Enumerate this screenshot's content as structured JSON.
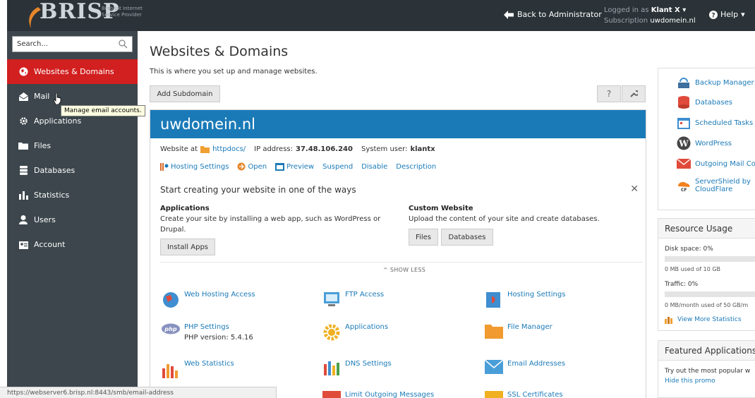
{
  "topbar": {
    "logo_text": "BRISP",
    "logo_tag_line1": "Brabant Internet",
    "logo_tag_line2": "Service Provider",
    "back_label": "Back to Administrator",
    "logged_in_label": "Logged in as",
    "user": "Klant X",
    "subscription_label": "Subscription",
    "subscription": "uwdomein.nl",
    "help_label": "Help"
  },
  "sidebar": {
    "search_placeholder": "Search...",
    "items": [
      {
        "label": "Websites & Domains",
        "icon": "globe-icon"
      },
      {
        "label": "Mail",
        "icon": "mail-icon"
      },
      {
        "label": "Applications",
        "icon": "gear-icon"
      },
      {
        "label": "Files",
        "icon": "folder-icon"
      },
      {
        "label": "Databases",
        "icon": "database-icon"
      },
      {
        "label": "Statistics",
        "icon": "bar-chart-icon"
      },
      {
        "label": "Users",
        "icon": "user-icon"
      },
      {
        "label": "Account",
        "icon": "account-icon"
      }
    ],
    "tooltip": "Manage email accounts."
  },
  "main": {
    "title": "Websites & Domains",
    "subtitle": "This is where you set up and manage websites.",
    "add_subdomain": "Add Subdomain",
    "help_q": "?",
    "domain": {
      "name": "uwdomein.nl",
      "website_at": "Website at",
      "docroot": "httpdocs/",
      "ip_label": "IP address:",
      "ip": "37.48.106.240",
      "sysuser_label": "System user:",
      "sysuser": "klantx",
      "actions": [
        "Hosting Settings",
        "Open",
        "Preview",
        "Suspend",
        "Disable",
        "Description"
      ]
    },
    "create": {
      "title": "Start creating your website in one of the ways",
      "apps_heading": "Applications",
      "apps_text_1": "Create your site by installing a web app, such as WordPress or",
      "apps_text_2": "Drupal.",
      "install_apps": "Install Apps",
      "custom_heading": "Custom Website",
      "custom_text": "Upload the content of your site and create databases.",
      "files_btn": "Files",
      "db_btn": "Databases",
      "show_less": "SHOW LESS"
    },
    "tools": [
      {
        "label": "Web Hosting Access",
        "icon": "web-hosting-access-icon"
      },
      {
        "label": "FTP Access",
        "icon": "ftp-access-icon"
      },
      {
        "label": "Hosting Settings",
        "icon": "hosting-settings-icon"
      },
      {
        "label": "PHP Settings",
        "sub": "PHP version: 5.4.16",
        "icon": "php-icon"
      },
      {
        "label": "Applications",
        "icon": "applications-gear-icon"
      },
      {
        "label": "File Manager",
        "icon": "file-manager-icon"
      },
      {
        "label": "Web Statistics",
        "icon": "web-statistics-icon"
      },
      {
        "label": "DNS Settings",
        "icon": "dns-settings-icon"
      },
      {
        "label": "Email Addresses",
        "icon": "email-addresses-icon"
      },
      {
        "label": "Limit Outgoing Messages",
        "icon": "limit-messages-icon"
      },
      {
        "label": "SSL Certificates",
        "icon": "ssl-certificates-icon"
      }
    ]
  },
  "right": {
    "links": [
      {
        "label": "Backup Manager",
        "icon": "backup-icon"
      },
      {
        "label": "Databases",
        "icon": "databases-icon"
      },
      {
        "label": "Scheduled Tasks",
        "icon": "calendar-icon"
      },
      {
        "label": "WordPress",
        "icon": "wordpress-icon"
      },
      {
        "label": "Outgoing Mail Co",
        "icon": "outgoing-mail-icon"
      },
      {
        "label": "ServerShield by",
        "label2": "CloudFlare",
        "icon": "cloudflare-icon"
      }
    ],
    "resource": {
      "title": "Resource Usage",
      "disk_label": "Disk space: 0%",
      "disk_used": "0 MB used of 10 GB",
      "disk_fraction": 0,
      "traffic_label": "Traffic: 0%",
      "traffic_used": "0 MB/month used of 50 GB/m",
      "traffic_fraction": 0,
      "view_more": "View More Statistics"
    },
    "featured": {
      "title": "Featured Applications",
      "text": "Try out the most popular w",
      "hide": "Hide this promo"
    }
  },
  "statusbar": "https://webserver6.brisp.nl:8443/smb/email-address",
  "colors": {
    "topbar": "#2b3338",
    "sidebar": "#3c464c",
    "active": "#d21f1f",
    "domain_header": "#1a7ab8",
    "link": "#1a7ab8"
  }
}
